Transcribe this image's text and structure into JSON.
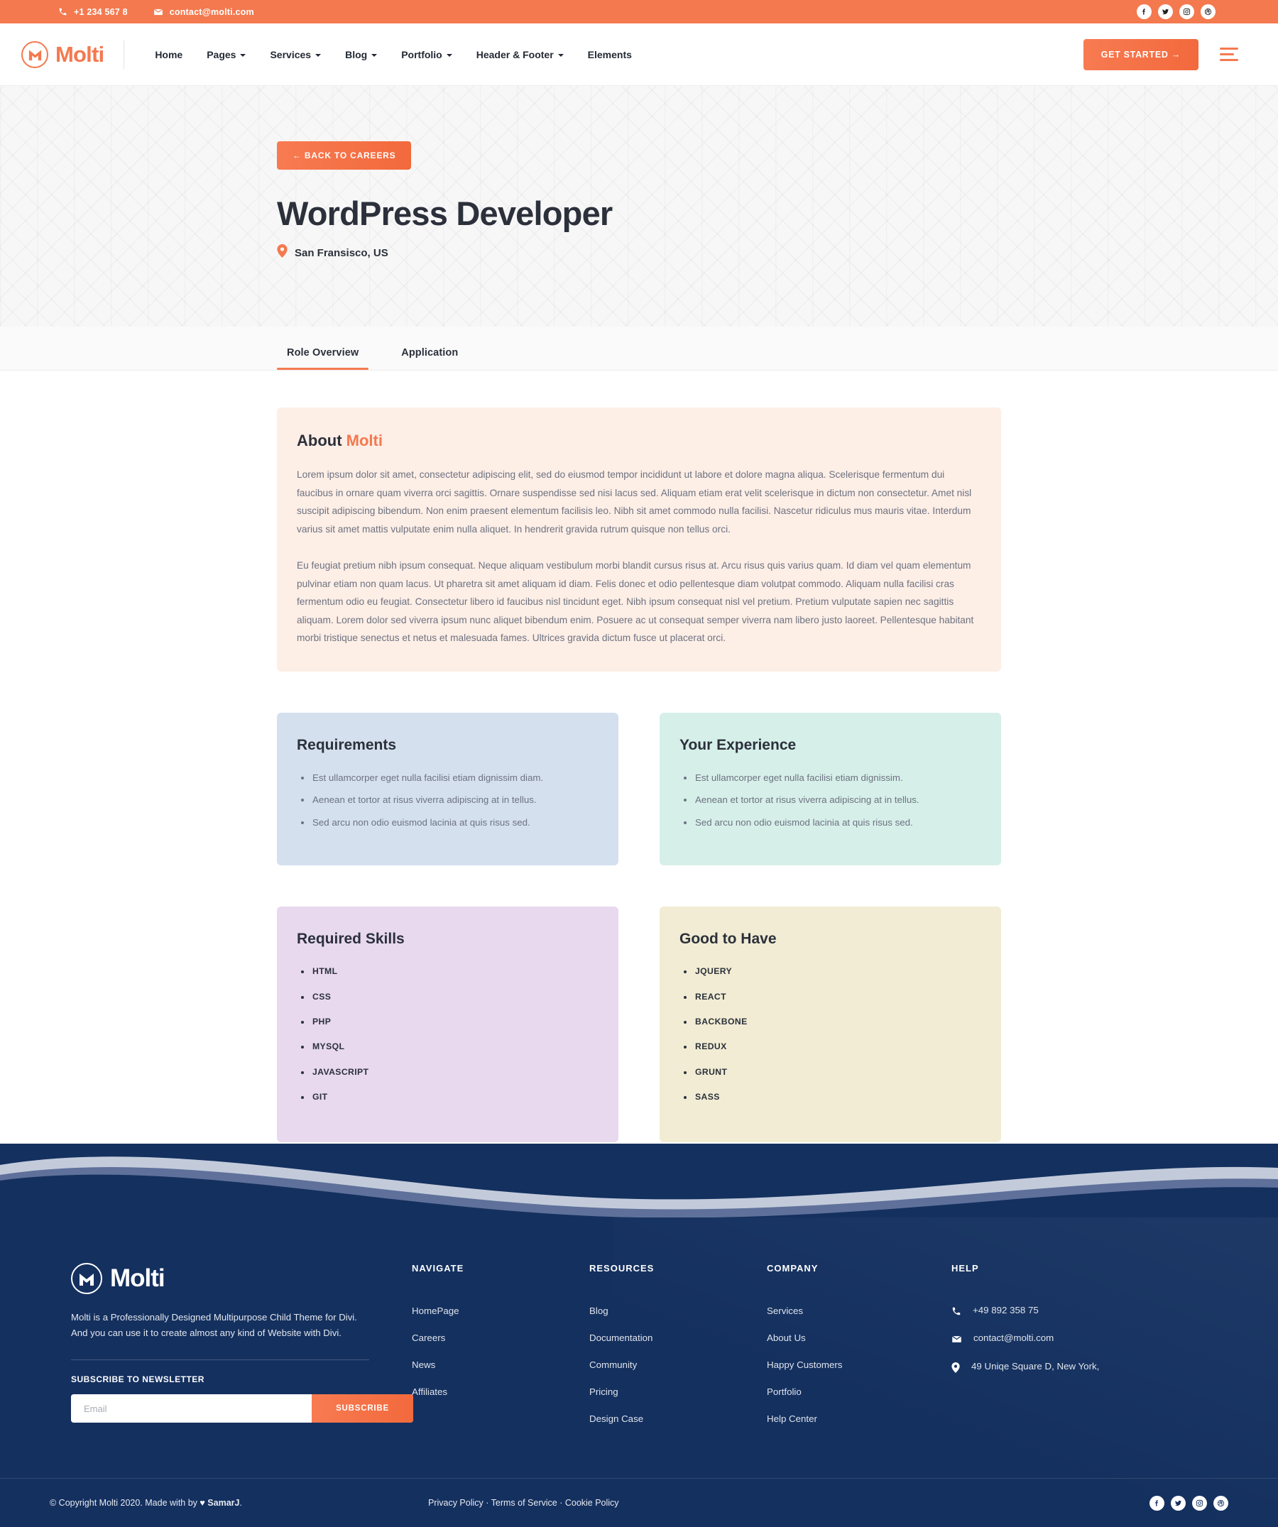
{
  "topbar": {
    "phone": "+1 234 567 8",
    "email": "contact@molti.com",
    "phone_icon": "phone-icon",
    "email_icon": "envelope-icon",
    "social": [
      {
        "name": "facebook-icon",
        "label": "Facebook"
      },
      {
        "name": "twitter-icon",
        "label": "Twitter"
      },
      {
        "name": "instagram-icon",
        "label": "Instagram"
      },
      {
        "name": "dribbble-icon",
        "label": "Dribbble"
      }
    ]
  },
  "nav": {
    "brand": "Molti",
    "links": [
      {
        "label": "Home",
        "caret": false
      },
      {
        "label": "Pages",
        "caret": true
      },
      {
        "label": "Services",
        "caret": true
      },
      {
        "label": "Blog",
        "caret": true
      },
      {
        "label": "Portfolio",
        "caret": true
      },
      {
        "label": "Header & Footer",
        "caret": true
      },
      {
        "label": "Elements",
        "caret": false
      }
    ],
    "cta": "GET STARTED  →"
  },
  "hero": {
    "back_label": "←  BACK TO CAREERS",
    "title": "WordPress Developer",
    "location": "San Fransisco, US"
  },
  "tabs": [
    {
      "label": "Role Overview",
      "active": true
    },
    {
      "label": "Application",
      "active": false
    }
  ],
  "about": {
    "title_plain": "About ",
    "title_accent": "Molti",
    "paragraph1": "Lorem ipsum dolor sit amet, consectetur adipiscing elit, sed do eiusmod tempor incididunt ut labore et dolore magna aliqua. Scelerisque fermentum dui faucibus in ornare quam viverra orci sagittis. Ornare suspendisse sed nisi lacus sed. Aliquam etiam erat velit scelerisque in dictum non consectetur. Amet nisl suscipit adipiscing bibendum. Non enim praesent elementum facilisis leo. Nibh sit amet commodo nulla facilisi. Nascetur ridiculus mus mauris vitae. Interdum varius sit amet mattis vulputate enim nulla aliquet. In hendrerit gravida rutrum quisque non tellus orci.",
    "paragraph2": "Eu feugiat pretium nibh ipsum consequat. Neque aliquam vestibulum morbi blandit cursus risus at. Arcu risus quis varius quam. Id diam vel quam elementum pulvinar etiam non quam lacus. Ut pharetra sit amet aliquam id diam. Felis donec et odio pellentesque diam volutpat commodo. Aliquam nulla facilisi cras fermentum odio eu feugiat. Consectetur libero id faucibus nisl tincidunt eget. Nibh ipsum consequat nisl vel pretium. Pretium vulputate sapien nec sagittis aliquam. Lorem dolor sed viverra ipsum nunc aliquet bibendum enim. Posuere ac ut consequat semper viverra nam libero justo laoreet. Pellentesque habitant morbi tristique senectus et netus et malesuada fames. Ultrices gravida dictum fusce ut placerat orci."
  },
  "cards": {
    "requirements": {
      "title": "Requirements",
      "items": [
        "Est ullamcorper eget nulla facilisi etiam dignissim diam.",
        "Aenean et tortor at risus viverra adipiscing at in tellus.",
        "Sed arcu non odio euismod lacinia at quis risus sed."
      ]
    },
    "experience": {
      "title": "Your Experience",
      "items": [
        "Est ullamcorper eget nulla facilisi etiam dignissim.",
        "Aenean et tortor at risus viverra adipiscing at in tellus.",
        "Sed arcu non odio euismod lacinia at quis risus sed."
      ]
    },
    "required_skills": {
      "title": "Required Skills",
      "items": [
        "HTML",
        "CSS",
        "PHP",
        "MYSQL",
        "JAVASCRIPT",
        "GIT"
      ]
    },
    "good_to_have": {
      "title": "Good to Have",
      "items": [
        "JQUERY",
        "REACT",
        "BACKBONE",
        "REDUX",
        "GRUNT",
        "SASS"
      ]
    }
  },
  "footer": {
    "brand": "Molti",
    "description": "Molti is a Professionally Designed  Multipurpose Child Theme for Divi. And you can use it to create almost any kind of Website with Divi.",
    "subscribe_label": "SUBSCRIBE TO NEWSLETTER",
    "email_placeholder": "Email",
    "email_value": "",
    "subscribe_button": "SUBSCRIBE",
    "columns": [
      {
        "heading": "NAVIGATE",
        "links": [
          "HomePage",
          "Careers",
          "News",
          "Affiliates"
        ]
      },
      {
        "heading": "RESOURCES",
        "links": [
          "Blog",
          "Documentation",
          "Community",
          "Pricing",
          "Design Case"
        ]
      },
      {
        "heading": "COMPANY",
        "links": [
          "Services",
          "About Us",
          "Happy Customers",
          "Portfolio",
          "Help Center"
        ]
      }
    ],
    "help": {
      "heading": "HELP",
      "phone": "+49 892 358 75",
      "email": "contact@molti.com",
      "address": "49 Uniqe Square D, New York,"
    },
    "copyright_pre": "© Copyright Molti 2020. Made with by ",
    "copyright_author": "SamarJ",
    "copyright_post": ".",
    "legal": "Privacy Policy · Terms of Service · Cookie Policy",
    "social": [
      {
        "name": "facebook-icon",
        "label": "Facebook"
      },
      {
        "name": "twitter-icon",
        "label": "Twitter"
      },
      {
        "name": "instagram-icon",
        "label": "Instagram"
      },
      {
        "name": "dribbble-icon",
        "label": "Dribbble"
      }
    ]
  },
  "colors": {
    "accent": "#f4794f",
    "footer_bg": "#14305f",
    "about_bg": "#fdeee6",
    "card_blue": "#d4e0ee",
    "card_mint": "#d6efe9",
    "card_lilac": "#e8d9ef",
    "card_cream": "#f1ecd3"
  }
}
